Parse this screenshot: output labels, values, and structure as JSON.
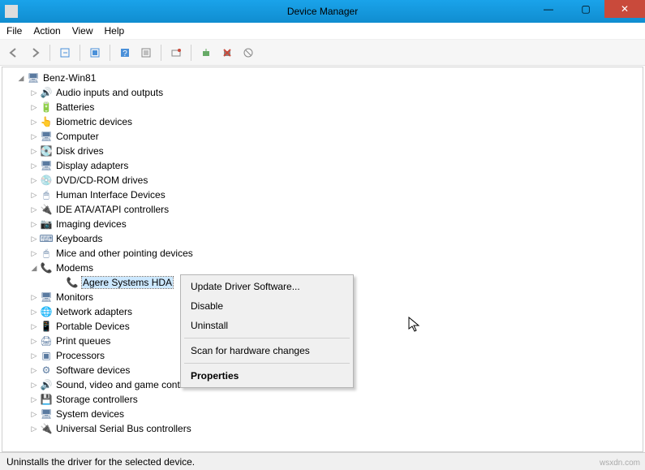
{
  "window": {
    "title": "Device Manager",
    "min": "—",
    "max": "▢",
    "close": "✕"
  },
  "menu": {
    "file": "File",
    "action": "Action",
    "view": "View",
    "help": "Help"
  },
  "tree": {
    "root": "Benz-Win81",
    "items": [
      "Audio inputs and outputs",
      "Batteries",
      "Biometric devices",
      "Computer",
      "Disk drives",
      "Display adapters",
      "DVD/CD-ROM drives",
      "Human Interface Devices",
      "IDE ATA/ATAPI controllers",
      "Imaging devices",
      "Keyboards",
      "Mice and other pointing devices",
      "Modems",
      "Monitors",
      "Network adapters",
      "Portable Devices",
      "Print queues",
      "Processors",
      "Software devices",
      "Sound, video and game controllers",
      "Storage controllers",
      "System devices",
      "Universal Serial Bus controllers"
    ],
    "expanded": "Modems",
    "child": "Agere Systems HDA"
  },
  "context": {
    "update": "Update Driver Software...",
    "disable": "Disable",
    "uninstall": "Uninstall",
    "scan": "Scan for hardware changes",
    "properties": "Properties"
  },
  "status": "Uninstalls the driver for the selected device.",
  "watermark": "wsxdn.com"
}
